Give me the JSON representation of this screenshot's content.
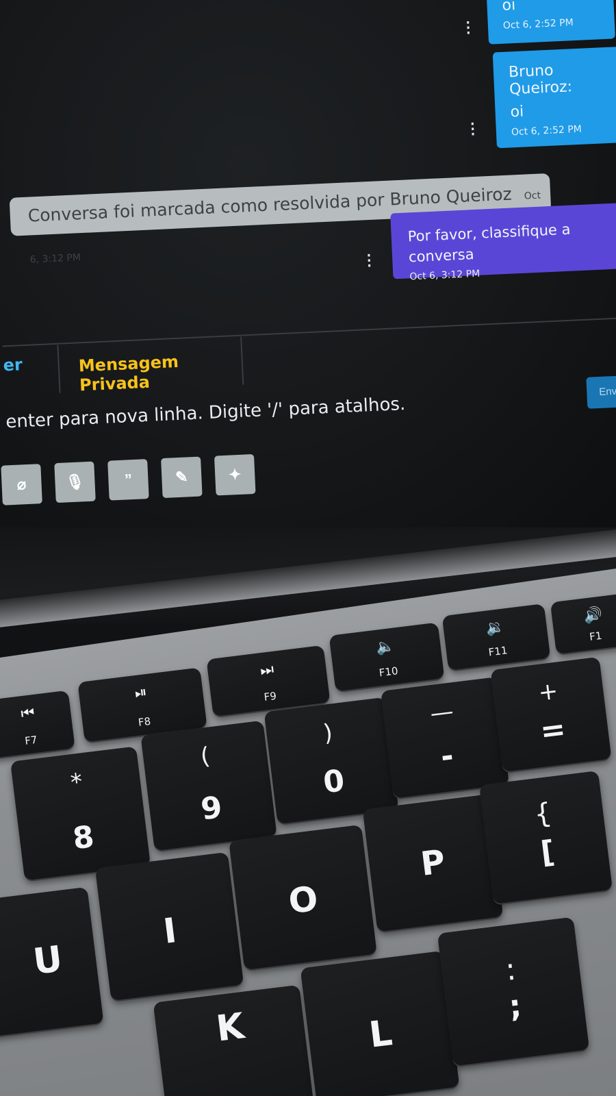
{
  "conversation": {
    "messages": [
      {
        "text": "oi",
        "time": "Oct 6, 2:52 PM"
      },
      {
        "sender": "Bruno Queiroz:",
        "text": "oi",
        "time": "Oct 6, 2:52 PM"
      }
    ],
    "system_event": {
      "text": "Conversa foi marcada como resolvida por Bruno Queiroz",
      "time": "Oct 6, 3:12 PM"
    },
    "bot_message": {
      "text": "Por favor, classifique a conversa",
      "time": "Oct 6, 3:12 PM"
    },
    "kebab_symbol": "⋮"
  },
  "composer": {
    "tabs": [
      {
        "label": "er"
      },
      {
        "label": "Mensagem Privada"
      }
    ],
    "hint": "enter para nova linha. Digite '/' para atalhos.",
    "send_label": "Enviar (",
    "tools": [
      {
        "icon": "paperclip-icon",
        "glyph": "⌀"
      },
      {
        "icon": "microphone-icon",
        "glyph": "🎙"
      },
      {
        "icon": "quote-icon",
        "glyph": "”"
      },
      {
        "icon": "signature-icon",
        "glyph": "✎"
      },
      {
        "icon": "magic-wand-icon",
        "glyph": "✦"
      }
    ]
  },
  "keyboard": {
    "function_keys": [
      {
        "symbol": "⏮",
        "label": "F7"
      },
      {
        "symbol": "⏯",
        "label": "F8"
      },
      {
        "symbol": "⏭",
        "label": "F9"
      },
      {
        "symbol": "🔈",
        "label": "F10"
      },
      {
        "symbol": "🔉",
        "label": "F11"
      },
      {
        "symbol": "🔊",
        "label": "F1"
      }
    ],
    "number_keys": [
      {
        "top": "*",
        "bottom": "8"
      },
      {
        "top": "(",
        "bottom": "9"
      },
      {
        "top": ")",
        "bottom": "0"
      },
      {
        "top": "—",
        "bottom": "-"
      },
      {
        "top": "+",
        "bottom": "="
      }
    ],
    "letter_keys_row1": [
      {
        "top": "",
        "bottom": ""
      },
      {
        "top": "",
        "bottom": "I"
      },
      {
        "top": "",
        "bottom": "O"
      },
      {
        "top": "",
        "bottom": "P"
      },
      {
        "top": "{",
        "bottom": "["
      }
    ],
    "letter_keys_row2": [
      {
        "label": "U"
      },
      {
        "label": "K"
      },
      {
        "label": "L"
      },
      {
        "top": ":",
        "bottom": ";"
      }
    ]
  }
}
